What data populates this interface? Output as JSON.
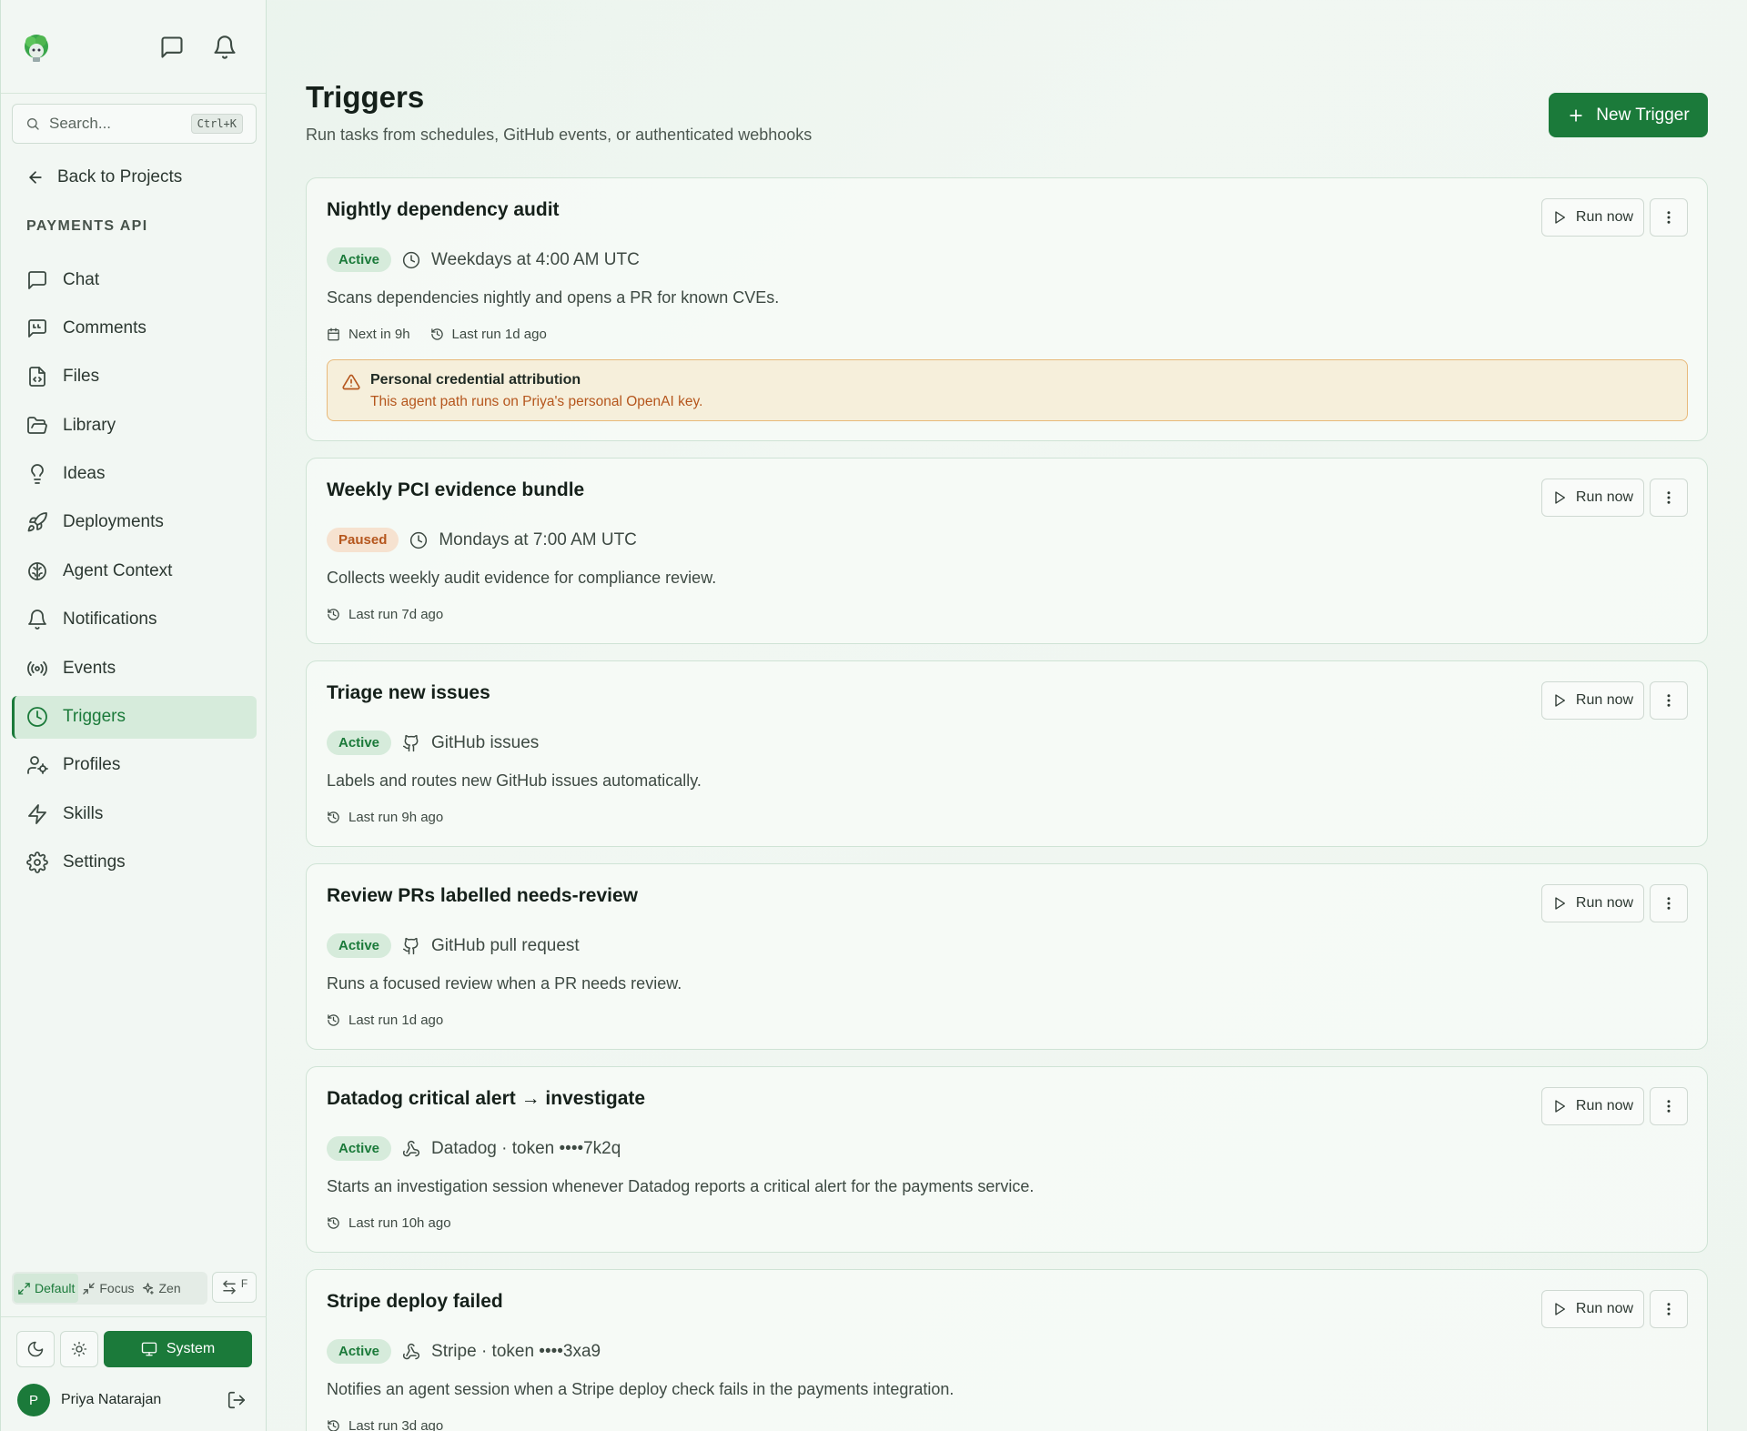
{
  "sidebar": {
    "search_placeholder": "Search...",
    "search_shortcut": "Ctrl+K",
    "back_label": "Back to Projects",
    "project_name": "PAYMENTS API",
    "items": [
      {
        "label": "Chat",
        "icon": "chat-icon"
      },
      {
        "label": "Comments",
        "icon": "comments-icon"
      },
      {
        "label": "Files",
        "icon": "file-code-icon"
      },
      {
        "label": "Library",
        "icon": "folder-open-icon"
      },
      {
        "label": "Ideas",
        "icon": "lightbulb-icon"
      },
      {
        "label": "Deployments",
        "icon": "rocket-icon"
      },
      {
        "label": "Agent Context",
        "icon": "brain-icon"
      },
      {
        "label": "Notifications",
        "icon": "bell-icon"
      },
      {
        "label": "Events",
        "icon": "broadcast-icon"
      },
      {
        "label": "Triggers",
        "icon": "clock-icon",
        "active": true
      },
      {
        "label": "Profiles",
        "icon": "user-cog-icon"
      },
      {
        "label": "Skills",
        "icon": "zap-icon"
      },
      {
        "label": "Settings",
        "icon": "gear-icon"
      }
    ],
    "modes": [
      {
        "label": "Default",
        "active": true
      },
      {
        "label": "Focus"
      },
      {
        "label": "Zen"
      }
    ],
    "swap_label": "F",
    "theme_system_label": "System",
    "user_name": "Priya Natarajan",
    "user_initial": "P"
  },
  "main": {
    "title": "Triggers",
    "subtitle": "Run tasks from schedules, GitHub events, or authenticated webhooks",
    "new_trigger_label": "New Trigger",
    "run_now_label": "Run now",
    "triggers": [
      {
        "name": "Nightly dependency audit",
        "status": "Active",
        "source_icon": "clock-icon",
        "source": "Weekdays at 4:00 AM UTC",
        "description": "Scans dependencies nightly and opens a PR for known CVEs.",
        "next_run": "Next in 9h",
        "last_run": "Last run 1d ago",
        "warning_title": "Personal credential attribution",
        "warning_text": "This agent path runs on Priya's personal OpenAI key."
      },
      {
        "name": "Weekly PCI evidence bundle",
        "status": "Paused",
        "source_icon": "clock-icon",
        "source": "Mondays at 7:00 AM UTC",
        "description": "Collects weekly audit evidence for compliance review.",
        "last_run": "Last run 7d ago"
      },
      {
        "name": "Triage new issues",
        "status": "Active",
        "source_icon": "github-icon",
        "source": "GitHub issues",
        "description": "Labels and routes new GitHub issues automatically.",
        "last_run": "Last run 9h ago"
      },
      {
        "name": "Review PRs labelled needs-review",
        "status": "Active",
        "source_icon": "github-icon",
        "source": "GitHub pull request",
        "description": "Runs a focused review when a PR needs review.",
        "last_run": "Last run 1d ago"
      },
      {
        "name": "Datadog critical alert → investigate",
        "status": "Active",
        "source_icon": "webhook-icon",
        "source": "Datadog · token ••••7k2q",
        "description": "Starts an investigation session whenever Datadog reports a critical alert for the payments service.",
        "last_run": "Last run 10h ago"
      },
      {
        "name": "Stripe deploy failed",
        "status": "Active",
        "source_icon": "webhook-icon",
        "source": "Stripe · token ••••3xa9",
        "description": "Notifies an agent session when a Stripe deploy check fails in the payments integration.",
        "last_run": "Last run 3d ago"
      }
    ]
  },
  "colors": {
    "brand": "#1b7a3a",
    "active_badge_bg": "#d6ebdb",
    "paused_badge_bg": "#f6e2d0",
    "paused_text": "#b5561d",
    "warning_bg": "#f6efdb",
    "warning_border": "#e8b97a"
  }
}
